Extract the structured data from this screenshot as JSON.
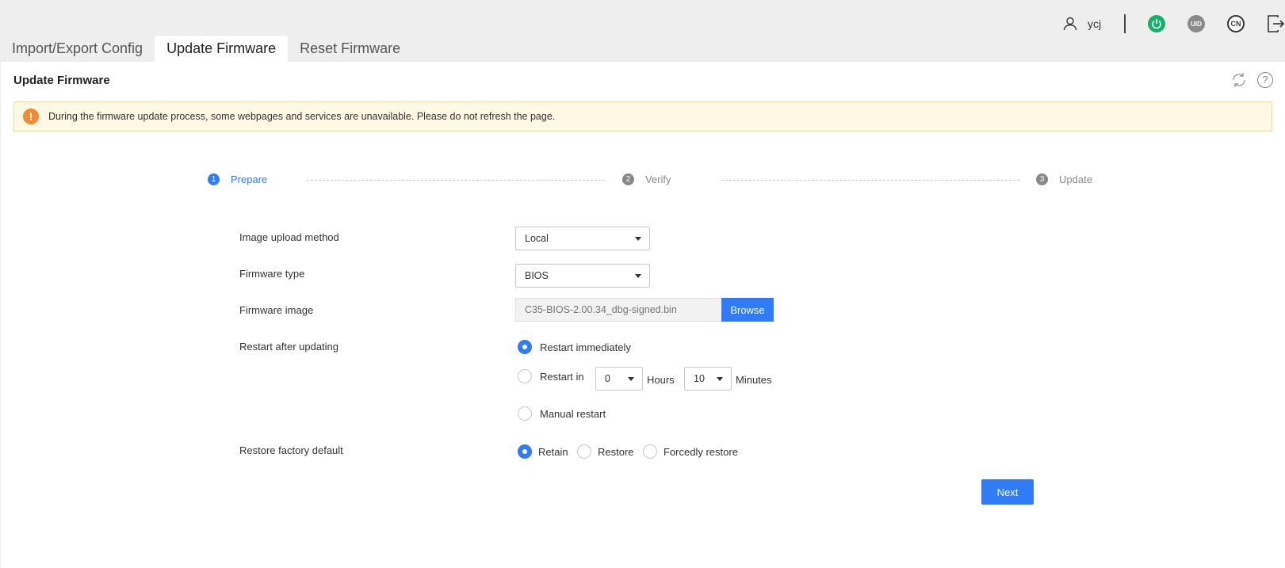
{
  "user": {
    "name": "ycj"
  },
  "top_icons": {
    "uid_label": "UID",
    "lang_label": "CN"
  },
  "tabs": [
    {
      "label": "Import/Export Config"
    },
    {
      "label": "Update Firmware",
      "active": true
    },
    {
      "label": "Reset Firmware"
    }
  ],
  "panel": {
    "title": "Update Firmware",
    "help_glyph": "?",
    "notice_glyph": "!",
    "notice": "During the firmware update process, some webpages and services are unavailable. Please do not refresh the page."
  },
  "steps": [
    {
      "num": "1",
      "label": "Prepare",
      "active": true
    },
    {
      "num": "2",
      "label": "Verify"
    },
    {
      "num": "3",
      "label": "Update"
    }
  ],
  "form": {
    "upload_method": {
      "label": "Image upload method",
      "value": "Local"
    },
    "firmware_type": {
      "label": "Firmware type",
      "value": "BIOS"
    },
    "firmware_image": {
      "label": "Firmware image",
      "placeholder": "C35-BIOS-2.00.34_dbg-signed.bin",
      "browse_label": "Browse"
    },
    "restart": {
      "label": "Restart after updating",
      "immediately": "Restart immediately",
      "restart_in": "Restart in",
      "hours_value": "0",
      "hours_label": "Hours",
      "minutes_value": "10",
      "minutes_label": "Minutes",
      "manual": "Manual restart",
      "selected": "immediately"
    },
    "restore": {
      "label": "Restore factory default",
      "retain": "Retain",
      "restore": "Restore",
      "forced": "Forcedly restore",
      "selected": "retain"
    }
  },
  "next_label": "Next",
  "colors": {
    "accent": "#2f7cf6",
    "power": "#15b06d",
    "warning": "#f28a30"
  }
}
